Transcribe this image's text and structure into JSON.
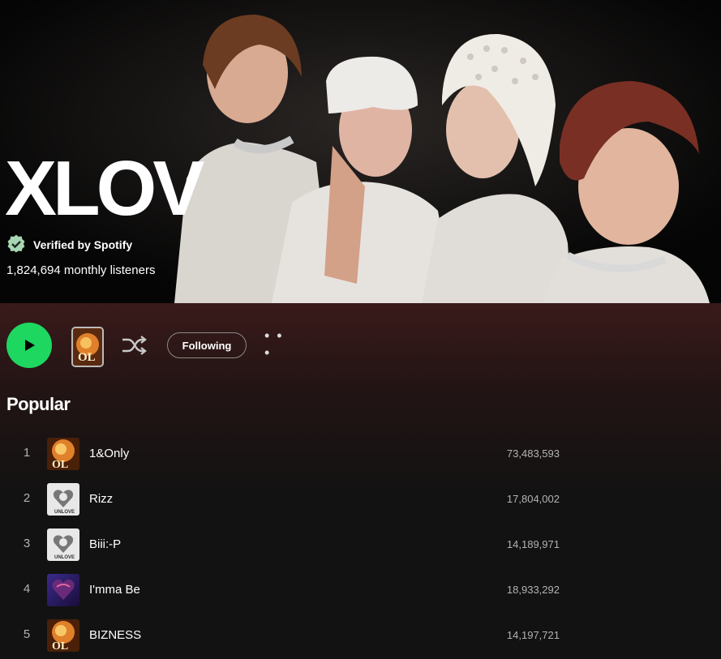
{
  "artist": {
    "name": "XLOV",
    "verified_label": "Verified by Spotify",
    "monthly_listeners": "1,824,694 monthly listeners"
  },
  "actions": {
    "following_label": "Following",
    "more_label": "• • •"
  },
  "popular": {
    "title": "Popular",
    "tracks": [
      {
        "num": "1",
        "title": "1&Only",
        "plays": "73,483,593",
        "art": "ol-album-art"
      },
      {
        "num": "2",
        "title": "Rizz",
        "plays": "17,804,002",
        "art": "unlove-album-art"
      },
      {
        "num": "3",
        "title": "Biii:-P",
        "plays": "14,189,971",
        "art": "unlove-album-art"
      },
      {
        "num": "4",
        "title": "I'mma Be",
        "plays": "18,933,292",
        "art": "heart-album-art"
      },
      {
        "num": "5",
        "title": "BIZNESS",
        "plays": "14,197,721",
        "art": "ol-album-art"
      }
    ]
  },
  "colors": {
    "accent_green": "#1ed760",
    "background": "#121212",
    "header_tint": "#3a1a1a"
  }
}
